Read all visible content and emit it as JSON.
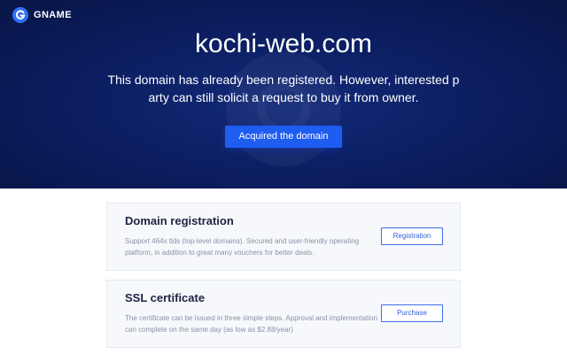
{
  "brand": {
    "name": "GNAME",
    "icon": "gname-logo-icon"
  },
  "hero": {
    "domain": "kochi-web.com",
    "message": "This domain has already been registered. However, interested party can still solicit a request to buy it from owner.",
    "cta_label": "Acquired the domain"
  },
  "cards": [
    {
      "title": "Domain registration",
      "description": "Support 464x tlds (top-level domains). Secured and user-friendly operating platform, in addition to great many vouchers for better deals.",
      "button_label": "Registration"
    },
    {
      "title": "SSL certificate",
      "description": "The certificate can be issued in three simple steps. Approval and implementation can complete on the same day (as low as $2.88/year)",
      "button_label": "Purchase"
    }
  ],
  "colors": {
    "hero_background": "#0c1f63",
    "accent": "#1f5cf0",
    "card_background": "#f6f8fc",
    "card_title": "#1d2442",
    "card_text": "#8a91a5"
  }
}
